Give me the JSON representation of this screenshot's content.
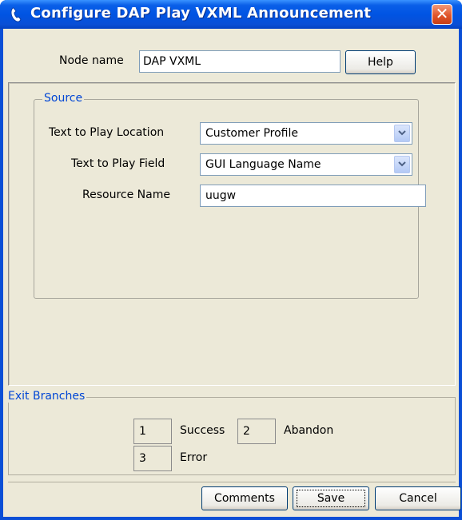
{
  "window": {
    "title": "Configure DAP Play VXML Announcement",
    "title_icon": "phone-icon",
    "close_icon": "close-icon",
    "accent_color": "#0054e3"
  },
  "node": {
    "label": "Node name",
    "value": "DAP VXML",
    "help_label": "Help"
  },
  "source": {
    "legend": "Source",
    "text_location": {
      "label": "Text to Play Location",
      "value": "Customer Profile"
    },
    "text_field": {
      "label": "Text to Play Field",
      "value": "GUI Language Name"
    },
    "resource_name": {
      "label": "Resource Name",
      "value": "uugw"
    }
  },
  "exit_branches": {
    "legend": "Exit Branches",
    "items": [
      {
        "number": "1",
        "label": "Success"
      },
      {
        "number": "2",
        "label": "Abandon"
      },
      {
        "number": "3",
        "label": "Error"
      }
    ]
  },
  "buttons": {
    "comments": "Comments",
    "save": "Save",
    "cancel": "Cancel"
  }
}
